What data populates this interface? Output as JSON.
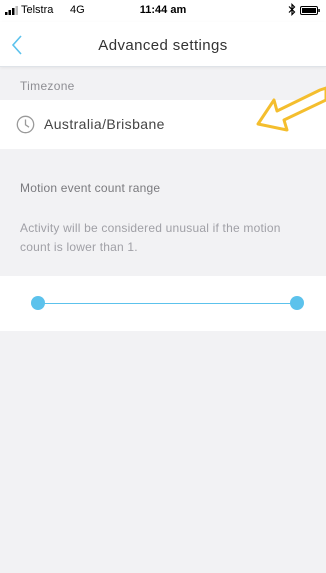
{
  "status_bar": {
    "carrier": "Telstra",
    "network": "4G",
    "time": "11:44 am",
    "icons": [
      "signal-icon",
      "bluetooth-icon",
      "battery-icon"
    ]
  },
  "nav": {
    "title": "Advanced settings",
    "back_icon": "chevron-left-icon"
  },
  "timezone": {
    "section_label": "Timezone",
    "value": "Australia/Brisbane",
    "icon": "clock-icon"
  },
  "motion": {
    "title": "Motion event count range",
    "description": "Activity will be considered unusual if the motion count is lower than 1."
  },
  "slider": {
    "min_fraction": 0,
    "max_fraction": 1
  },
  "annotation": {
    "icon": "arrow-annotation",
    "color": "#f4be2e"
  },
  "colors": {
    "accent": "#5cc2ec",
    "background": "#f2f2f4"
  }
}
